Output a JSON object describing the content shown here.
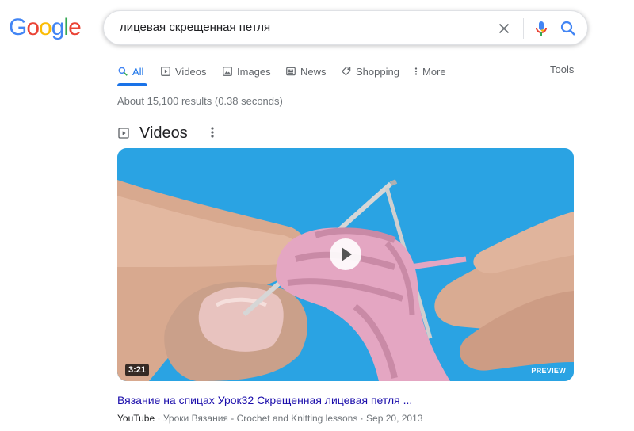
{
  "logo": {
    "letters": [
      "G",
      "o",
      "o",
      "g",
      "l",
      "e"
    ],
    "colors": [
      "#4285f4",
      "#ea4335",
      "#fbbc05",
      "#4285f4",
      "#34a853",
      "#ea4335"
    ]
  },
  "search": {
    "query": "лицевая скрещенная петля"
  },
  "tabs": [
    {
      "label": "All",
      "icon": "search-icon",
      "active": true
    },
    {
      "label": "Videos",
      "icon": "video-icon"
    },
    {
      "label": "Images",
      "icon": "image-icon"
    },
    {
      "label": "News",
      "icon": "news-icon"
    },
    {
      "label": "Shopping",
      "icon": "tag-icon"
    },
    {
      "label": "More",
      "icon": "more-vert-icon"
    }
  ],
  "tools_label": "Tools",
  "result_stats": "About 15,100 results (0.38 seconds)",
  "videos_section": {
    "title": "Videos",
    "video": {
      "duration": "3:21",
      "preview_label": "PREVIEW",
      "title": "Вязание на спицах Урок32 Скрещенная лицевая петля ...",
      "source": "YouTube",
      "channel": "Уроки Вязания - Crochet and Knitting lessons",
      "date": "Sep 20, 2013"
    }
  },
  "colors": {
    "accent": "#1a73e8",
    "link": "#1a0dab",
    "thumb_bg": "#2aa3e3"
  }
}
